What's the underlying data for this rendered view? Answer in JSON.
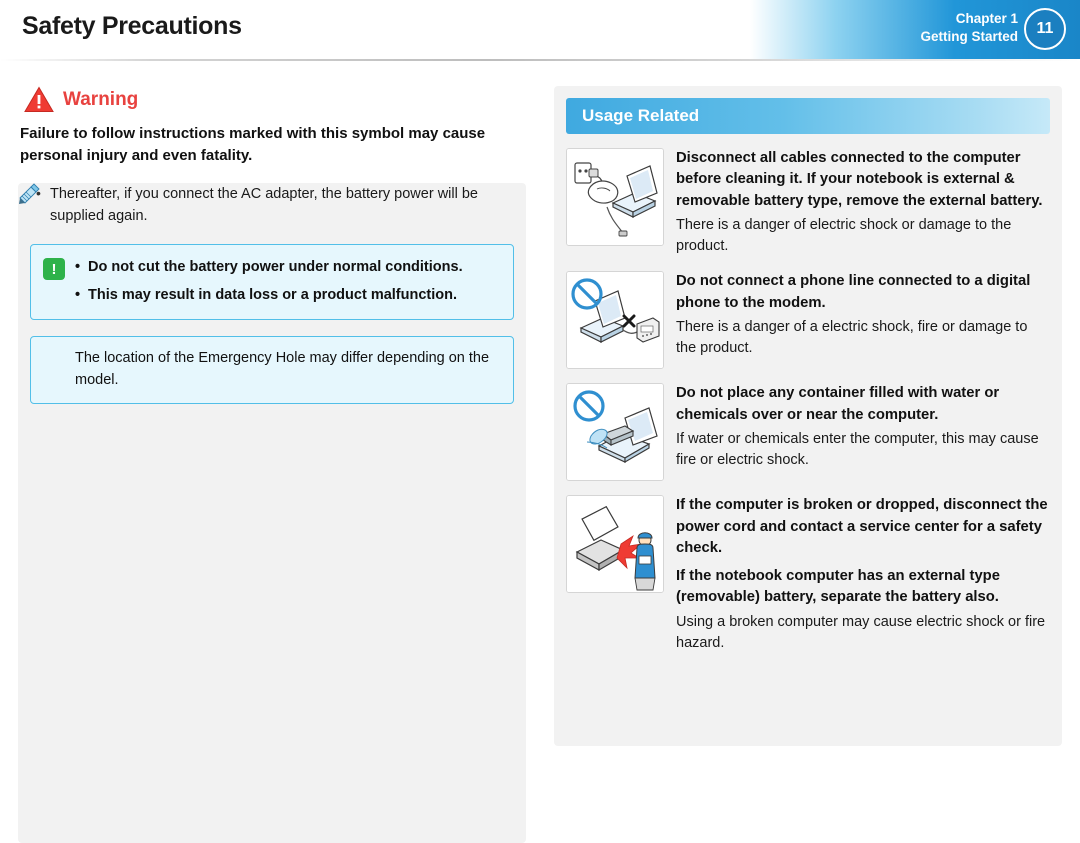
{
  "header": {
    "title": "Safety Precautions",
    "chapter_line1": "Chapter 1",
    "chapter_line2": "Getting Started",
    "page_number": "11",
    "accent_color": "#2196d8"
  },
  "left": {
    "warning_label": "Warning",
    "warning_icon": "warning-triangle-icon",
    "warning_description": "Failure to follow instructions marked with this symbol may cause personal injury and even fatality.",
    "bullet": {
      "marker": "•",
      "text": "Thereafter, if you connect the AC adapter, the battery power will be supplied again."
    },
    "caution_box": {
      "icon_label": "!",
      "icon_name": "exclamation-icon",
      "items": [
        {
          "marker": "•",
          "text": "Do not cut the battery power under normal conditions."
        },
        {
          "marker": "•",
          "text": "This may result in data loss or a product malfunction."
        }
      ]
    },
    "note_box": {
      "icon_name": "pencil-note-icon",
      "text": "The location of the Emergency Hole may differ depending on the model."
    }
  },
  "right": {
    "section_title": "Usage Related",
    "entries": [
      {
        "figure": "cleaning-computer-unplug-illustration",
        "title": "Disconnect all cables connected to the computer before cleaning it. If your notebook is external & removable battery type, remove the external battery.",
        "subtitle": "There is a danger of electric shock or damage to the product."
      },
      {
        "figure": "no-phone-line-to-modem-illustration",
        "title": "Do not connect a phone line connected to a digital phone to the modem.",
        "subtitle": "There is a danger of a electric shock, fire or damage to the product."
      },
      {
        "figure": "no-liquid-container-illustration",
        "title": "Do not place any container filled with water or chemicals over or near the computer.",
        "subtitle": "If water or chemicals enter the computer, this may cause fire or electric shock."
      },
      {
        "figure": "broken-computer-service-center-illustration",
        "title": "If the computer is broken or dropped, disconnect the power cord and contact a service center for a safety check.",
        "title2": "If the notebook computer has an external type (removable) battery, separate the battery also.",
        "subtitle": "Using a broken computer may cause electric shock or fire hazard."
      }
    ]
  }
}
